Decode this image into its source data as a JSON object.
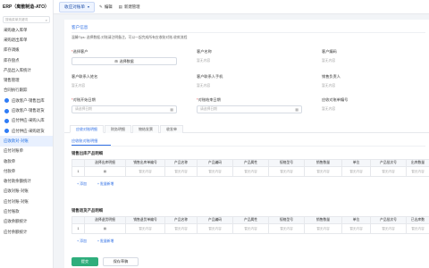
{
  "sidebar": {
    "header": "ERP（离散制造-ATO）",
    "search_placeholder": "搜索菜单关键词",
    "items": [
      {
        "label": "采购收入库单",
        "type": "plain",
        "active": false
      },
      {
        "label": "采购退出库单",
        "type": "plain",
        "active": false
      },
      {
        "label": "库存调拨",
        "type": "plain",
        "active": false
      },
      {
        "label": "库存盘点",
        "type": "plain",
        "active": false
      },
      {
        "label": "产品出入库统计",
        "type": "plain",
        "active": false
      },
      {
        "label": "销售管理",
        "type": "plain",
        "active": false
      },
      {
        "label": "合同执行跟踪",
        "type": "plain",
        "active": false
      },
      {
        "label": "应收客户-销售出库",
        "type": "dot",
        "active": false
      },
      {
        "label": "应收客户-销售退货",
        "type": "dot",
        "active": false
      },
      {
        "label": "应付供应-采购入库",
        "type": "dot",
        "active": false
      },
      {
        "label": "应付供应-采购退货",
        "type": "dot",
        "active": false
      },
      {
        "label": "应收款对-对账",
        "type": "plain",
        "active": true
      },
      {
        "label": "应付对账单",
        "type": "plain",
        "active": false
      },
      {
        "label": "收款单",
        "type": "plain",
        "active": false
      },
      {
        "label": "付款单",
        "type": "plain",
        "active": false
      },
      {
        "label": "收付款余额统计",
        "type": "plain",
        "active": false
      },
      {
        "label": "应收对账-对账",
        "type": "plain",
        "active": false
      },
      {
        "label": "应付对账-对账",
        "type": "plain",
        "active": false
      },
      {
        "label": "应付账款",
        "type": "plain",
        "active": false
      },
      {
        "label": "应收余额统计",
        "type": "plain",
        "active": false
      },
      {
        "label": "应付余额统计",
        "type": "plain",
        "active": false
      }
    ]
  },
  "topbar": {
    "tab_label": "收应对账单",
    "edit_label": "编辑",
    "new_label": "新建管理"
  },
  "form": {
    "section_title": "客户信息",
    "notice": "温馨Tips: 选择数据-对账请注明备注，可以一起完成所有应收账对账-收款流程",
    "fields": {
      "customer": {
        "label": "选择客户",
        "button": "选择数据"
      },
      "customer_name": {
        "label": "客户名称",
        "placeholder": "暂无内容"
      },
      "customer_code": {
        "label": "客户编码",
        "placeholder": "暂无内容"
      },
      "contact_name": {
        "label": "客户联系人姓名",
        "placeholder": "暂无内容"
      },
      "contact_phone": {
        "label": "客户联系人手机",
        "placeholder": "暂无内容"
      },
      "sales_owner": {
        "label": "销售负责人",
        "placeholder": "暂无内容"
      },
      "start_date": {
        "label": "对账开始日期",
        "placeholder": "请选择日期"
      },
      "end_date": {
        "label": "对账结束日期",
        "placeholder": "请选择日期"
      },
      "recon_no": {
        "label": "应收对账单编号",
        "placeholder": "暂无内容"
      }
    }
  },
  "tabs": [
    "应收对账明细",
    "财务明细",
    "物结发票",
    "收发单"
  ],
  "subtab": "应收账对账明细",
  "table1": {
    "title": "销售出库产品明细",
    "columns": [
      "选择出库明细",
      "销售出库单编号",
      "产品名称",
      "产品编码",
      "产品属性",
      "规格型号",
      "销售数量",
      "单位",
      "产品批次号",
      "出库数量"
    ],
    "row_index": "1",
    "row_placeholder": "暂无内容",
    "add_label": "添加",
    "batch_label": "批量新增"
  },
  "table2": {
    "title": "销售退货产品明细",
    "columns": [
      "选择退货明细",
      "销售退货单编号",
      "产品名称",
      "产品编码",
      "产品属性",
      "规格型号",
      "销售数量",
      "单位",
      "产品批次号",
      "已出库数"
    ],
    "row_index": "1",
    "row_placeholder": "暂无内容",
    "add_label": "添加",
    "batch_label": "批量新增"
  },
  "footer": {
    "save_label": "提交",
    "audit_label": "保存草稿"
  },
  "colors": {
    "accent": "#2f6fe5",
    "save": "#2fae7c",
    "active_bg": "#e8f0fe"
  }
}
